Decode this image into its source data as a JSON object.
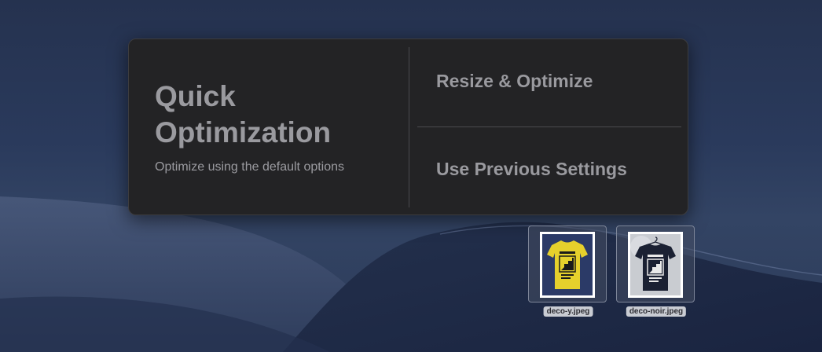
{
  "panel": {
    "quick": {
      "title": "Quick Optimization",
      "subtitle": "Optimize using the default options"
    },
    "options": [
      {
        "label": "Resize & Optimize"
      },
      {
        "label": "Use Previous Settings"
      }
    ]
  },
  "files": [
    {
      "name": "deco-y.jpeg",
      "icon": "tshirt-yellow-icon",
      "shirt_color": "#e6d02c",
      "bg_color": "#2b3a67"
    },
    {
      "name": "deco-noir.jpeg",
      "icon": "tshirt-black-icon",
      "shirt_color": "#1b2133",
      "bg_color": "#c9ccd1"
    }
  ],
  "colors": {
    "panel_bg": "#232325",
    "text": "#9a9a9f",
    "divider": "#4a4a4e"
  }
}
